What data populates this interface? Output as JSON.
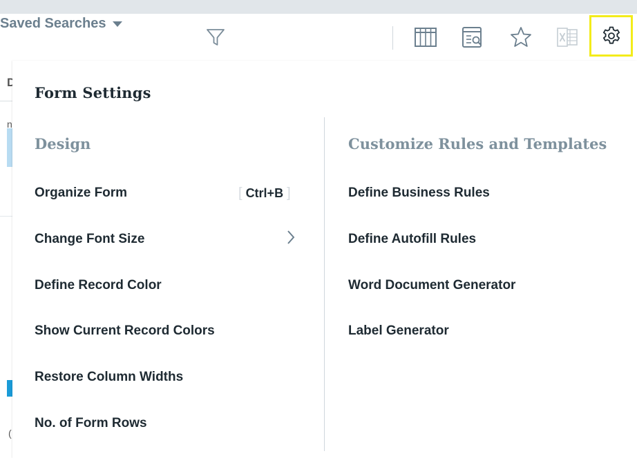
{
  "toolbar": {
    "filter_icon": "filter-icon",
    "saved_searches_label": "Saved Searches",
    "columns_icon": "columns-icon",
    "report_icon": "report-preview-icon",
    "favorite_icon": "star-icon",
    "excel_icon": "excel-icon",
    "settings_icon": "gear-icon",
    "highlight_color": "#f3ec1a"
  },
  "background": {
    "fragment_1": "D",
    "fragment_2": "n",
    "fragment_3": "("
  },
  "menu": {
    "title": "Form Settings",
    "design": {
      "heading": "Design",
      "items": [
        {
          "label": "Organize Form",
          "shortcut": "Ctrl+B"
        },
        {
          "label": "Change Font Size",
          "submenu": true
        },
        {
          "label": "Define Record Color"
        },
        {
          "label": "Show Current Record Colors"
        },
        {
          "label": "Restore Column Widths"
        },
        {
          "label": "No. of Form Rows"
        }
      ]
    },
    "customize": {
      "heading": "Customize Rules and Templates",
      "items": [
        {
          "label": "Define Business Rules"
        },
        {
          "label": "Define Autofill Rules"
        },
        {
          "label": "Word Document Generator"
        },
        {
          "label": "Label Generator"
        }
      ]
    }
  },
  "colors": {
    "text_dark": "#1e2a32",
    "section_heading": "#7e919d",
    "toolbar_icon": "#6b7f8e",
    "top_strip": "#e1e6ea"
  }
}
